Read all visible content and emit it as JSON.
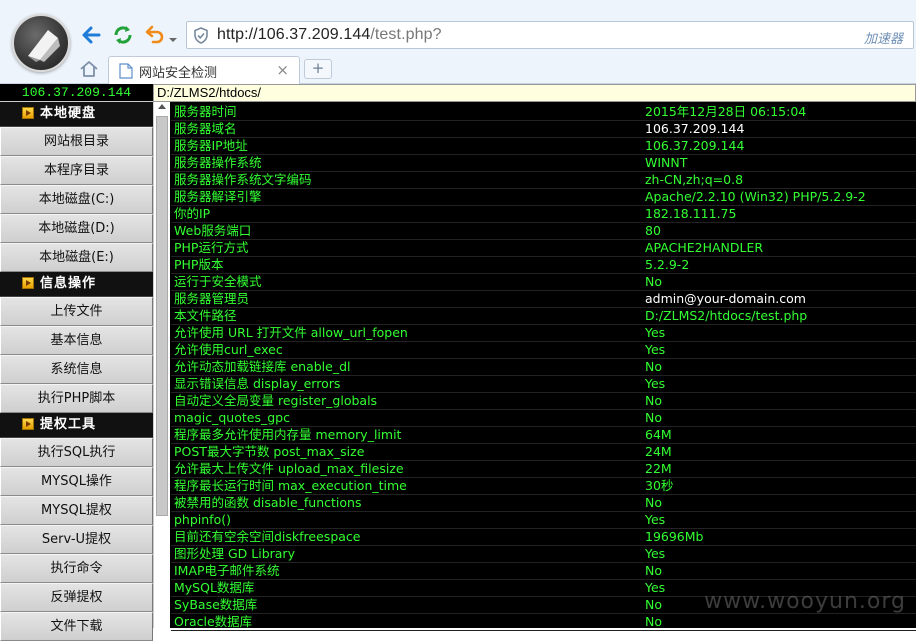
{
  "browser": {
    "url_main": "http://106.37.209.144",
    "url_rest": "/test.php?",
    "accelerator_label": "加速器",
    "tab_title": "网站安全检测",
    "tab_close": "×",
    "new_tab": "+"
  },
  "page": {
    "server_ip": "106.37.209.144",
    "path_value": "D:/ZLMS2/htdocs/",
    "watermark": "www.wooyun.org"
  },
  "sidebar": {
    "sections": [
      {
        "title": "本地硬盘",
        "items": [
          "网站根目录",
          "本程序目录",
          "本地磁盘(C:)",
          "本地磁盘(D:)",
          "本地磁盘(E:)"
        ]
      },
      {
        "title": "信息操作",
        "items": [
          "上传文件",
          "基本信息",
          "系统信息",
          "执行PHP脚本"
        ]
      },
      {
        "title": "提权工具",
        "items": [
          "执行SQL执行",
          "MYSQL操作",
          "MYSQL提权",
          "Serv-U提权",
          "执行命令",
          "反弹提权",
          "文件下载"
        ]
      }
    ]
  },
  "info_rows": [
    {
      "key": "服务器时间",
      "value": "2015年12月28日 06:15:04",
      "white": false
    },
    {
      "key": "服务器域名",
      "value": "106.37.209.144",
      "white": true
    },
    {
      "key": "服务器IP地址",
      "value": "106.37.209.144",
      "white": false
    },
    {
      "key": "服务器操作系统",
      "value": "WINNT",
      "white": false
    },
    {
      "key": "服务器操作系统文字编码",
      "value": "zh-CN,zh;q=0.8",
      "white": false
    },
    {
      "key": "服务器解译引擎",
      "value": "Apache/2.2.10 (Win32) PHP/5.2.9-2",
      "white": false
    },
    {
      "key": "你的IP",
      "value": "182.18.111.75",
      "white": false
    },
    {
      "key": "Web服务端口",
      "value": "80",
      "white": false
    },
    {
      "key": "PHP运行方式",
      "value": "APACHE2HANDLER",
      "white": false
    },
    {
      "key": "PHP版本",
      "value": "5.2.9-2",
      "white": false
    },
    {
      "key": "运行于安全模式",
      "value": "No",
      "white": false
    },
    {
      "key": "服务器管理员",
      "value": "admin@your-domain.com",
      "white": true
    },
    {
      "key": "本文件路径",
      "value": "D:/ZLMS2/htdocs/test.php",
      "white": false
    },
    {
      "key": "允许使用 URL 打开文件 allow_url_fopen",
      "value": "Yes",
      "white": false
    },
    {
      "key": "允许使用curl_exec",
      "value": "Yes",
      "white": false
    },
    {
      "key": "允许动态加载链接库 enable_dl",
      "value": "No",
      "white": false
    },
    {
      "key": "显示错误信息 display_errors",
      "value": "Yes",
      "white": false
    },
    {
      "key": "自动定义全局变量 register_globals",
      "value": "No",
      "white": false
    },
    {
      "key": "magic_quotes_gpc",
      "value": "No",
      "white": false
    },
    {
      "key": "程序最多允许使用内存量 memory_limit",
      "value": "64M",
      "white": false
    },
    {
      "key": "POST最大字节数 post_max_size",
      "value": "24M",
      "white": false
    },
    {
      "key": "允许最大上传文件 upload_max_filesize",
      "value": "22M",
      "white": false
    },
    {
      "key": "程序最长运行时间 max_execution_time",
      "value": "30秒",
      "white": false
    },
    {
      "key": "被禁用的函数 disable_functions",
      "value": "No",
      "white": false
    },
    {
      "key": "phpinfo()",
      "value": "Yes",
      "white": false
    },
    {
      "key": "目前还有空余空间diskfreespace",
      "value": "19696Mb",
      "white": false
    },
    {
      "key": "图形处理 GD Library",
      "value": "Yes",
      "white": false
    },
    {
      "key": "IMAP电子邮件系统",
      "value": "No",
      "white": false
    },
    {
      "key": "MySQL数据库",
      "value": "Yes",
      "white": false
    },
    {
      "key": "SyBase数据库",
      "value": "No",
      "white": false
    },
    {
      "key": "Oracle数据库",
      "value": "No",
      "white": false
    }
  ]
}
